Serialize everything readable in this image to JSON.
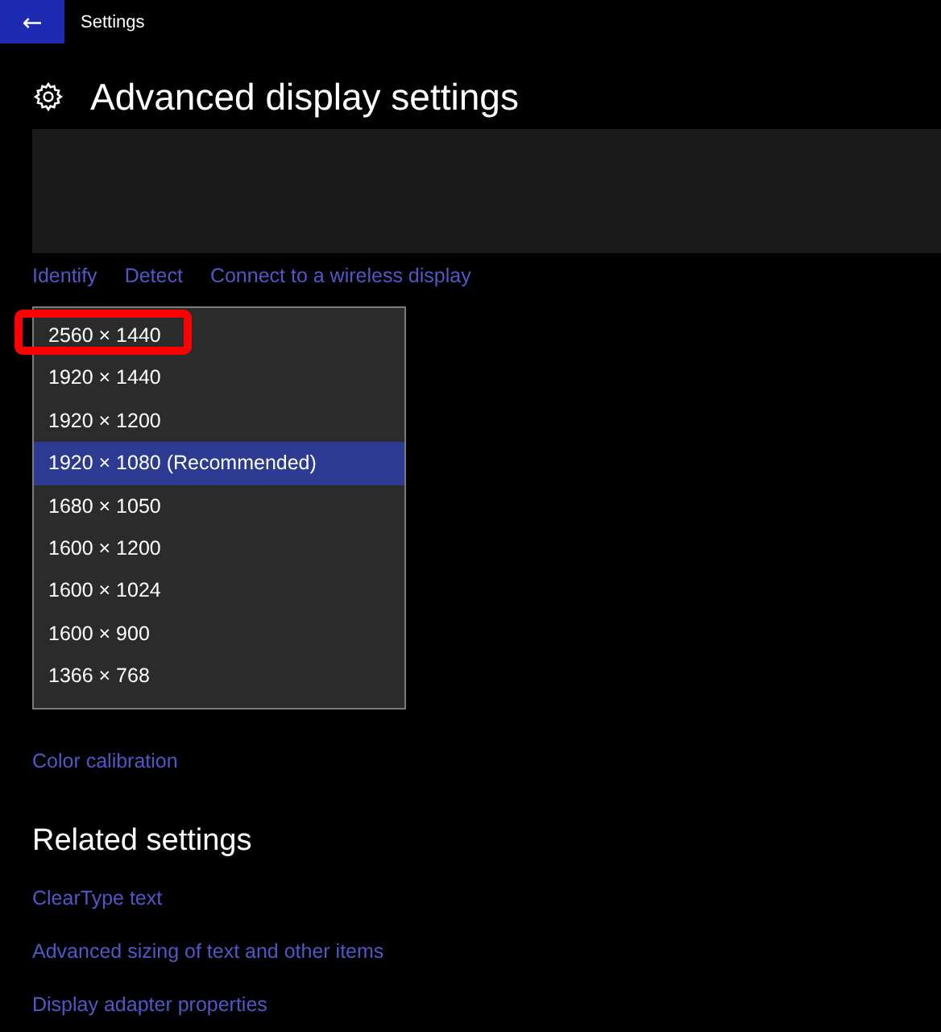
{
  "window": {
    "title": "Settings",
    "back_button": "←"
  },
  "page": {
    "title": "Advanced display settings"
  },
  "display_links": [
    "Identify",
    "Detect",
    "Connect to a wireless display"
  ],
  "resolution_dropdown": {
    "options": [
      {
        "label": "2560 × 1440",
        "selected": false,
        "highlighted": true
      },
      {
        "label": "1920 × 1440",
        "selected": false,
        "highlighted": false
      },
      {
        "label": "1920 × 1200",
        "selected": false,
        "highlighted": false
      },
      {
        "label": "1920 × 1080 (Recommended)",
        "selected": true,
        "highlighted": false
      },
      {
        "label": "1680 × 1050",
        "selected": false,
        "highlighted": false
      },
      {
        "label": "1600 × 1200",
        "selected": false,
        "highlighted": false
      },
      {
        "label": "1600 × 1024",
        "selected": false,
        "highlighted": false
      },
      {
        "label": "1600 × 900",
        "selected": false,
        "highlighted": false
      },
      {
        "label": "1366 × 768",
        "selected": false,
        "highlighted": false
      }
    ]
  },
  "color_link": "Color calibration",
  "related": {
    "title": "Related settings",
    "links": [
      "ClearType text",
      "Advanced sizing of text and other items",
      "Display adapter properties"
    ]
  }
}
